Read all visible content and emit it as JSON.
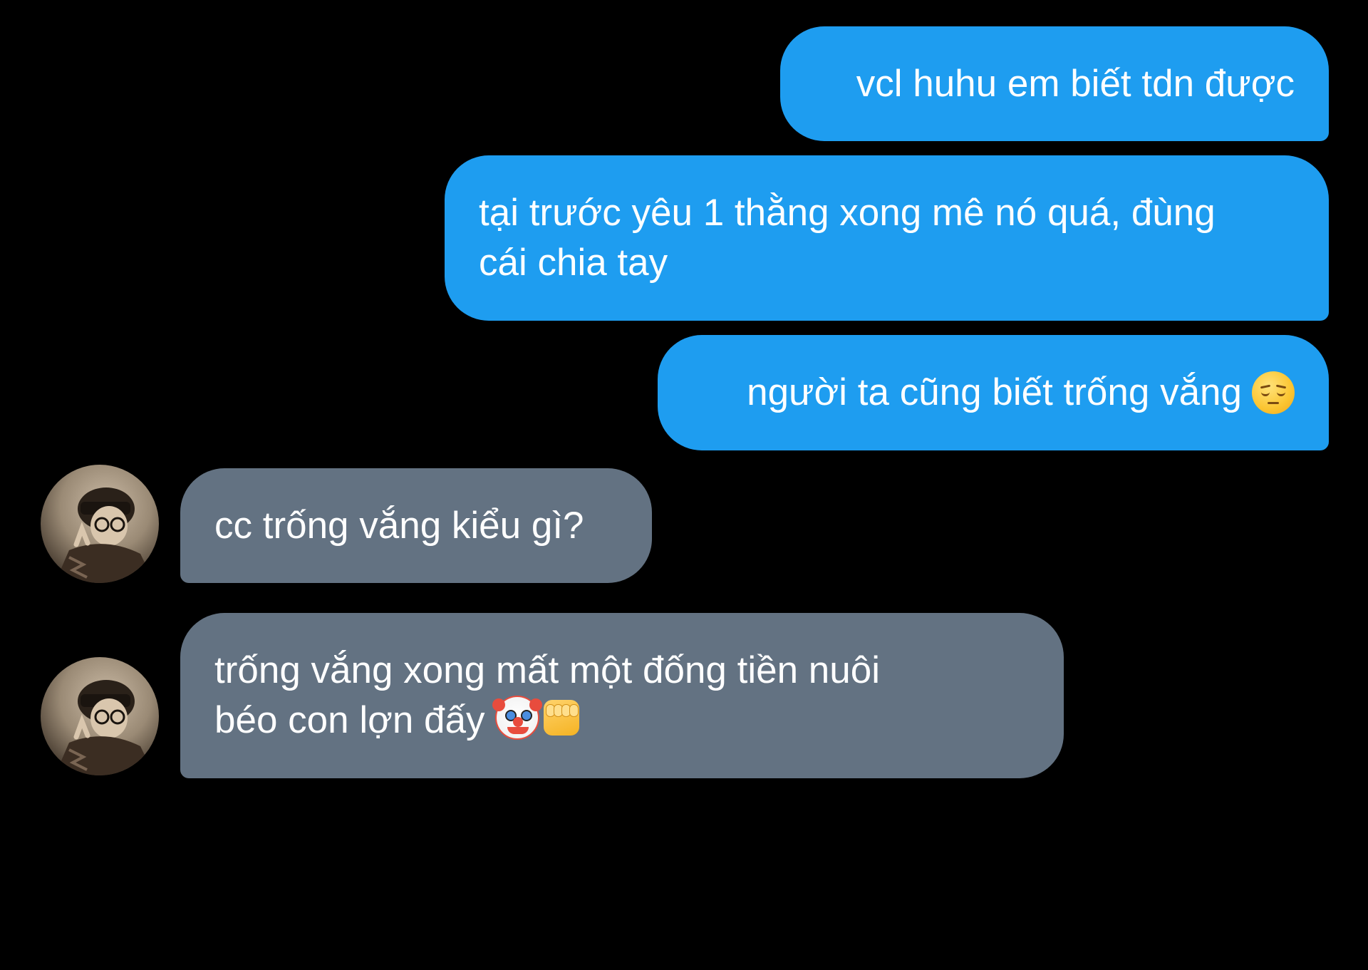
{
  "conversation": {
    "messages": [
      {
        "sender": "me",
        "text": "vcl huhu em biết tdn được"
      },
      {
        "sender": "me",
        "text": "tại trước yêu 1 thằng xong mê nó quá, đùng\ncái chia tay"
      },
      {
        "sender": "me",
        "text": "người ta cũng biết trống vắng",
        "emoji": "pensive-face-icon"
      },
      {
        "sender": "other",
        "text": "cc trống vắng kiểu gì?"
      },
      {
        "sender": "other",
        "text": "trống vắng xong mất một đống tiền nuôi\nbéo con lợn đấy",
        "emoji": [
          "clown-face-icon",
          "oncoming-fist-icon"
        ]
      }
    ]
  },
  "colors": {
    "background": "#000000",
    "sent_bubble": "#1e9df0",
    "received_bubble": "#637282",
    "text": "#ffffff"
  }
}
